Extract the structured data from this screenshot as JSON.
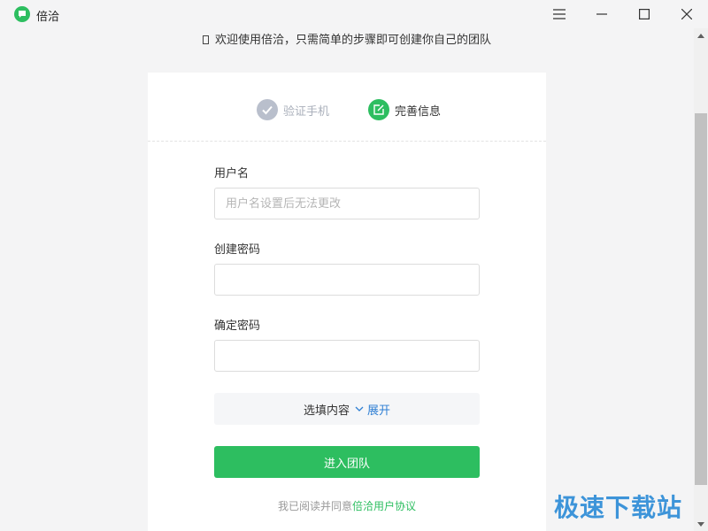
{
  "window": {
    "title": "倍洽",
    "logo_icon": "chat-bubble-logo-icon",
    "controls": [
      "menu-icon",
      "minimize-icon",
      "maximize-icon",
      "close-icon"
    ]
  },
  "banner": {
    "text": "欢迎使用倍洽，只需简单的步骤即可创建你自己的团队"
  },
  "steps": [
    {
      "label": "验证手机",
      "state": "completed",
      "icon": "check-icon"
    },
    {
      "label": "完善信息",
      "state": "active",
      "icon": "edit-icon"
    }
  ],
  "form": {
    "username": {
      "label": "用户名",
      "placeholder": "用户名设置后无法更改",
      "value": ""
    },
    "password": {
      "label": "创建密码",
      "value": ""
    },
    "confirm_password": {
      "label": "确定密码",
      "value": ""
    },
    "optional": {
      "label": "选填内容",
      "toggle": "展开",
      "icon": "chevron-down-icon"
    },
    "submit_label": "进入团队"
  },
  "agreement": {
    "prefix": "我已阅读并同意",
    "link": "倍洽用户协议"
  },
  "watermark": "极速下载站",
  "colors": {
    "accent": "#2dbe60",
    "link": "#2f7fd3",
    "step_inactive": "#b9bfcc",
    "watermark": "#2a8ad6"
  }
}
